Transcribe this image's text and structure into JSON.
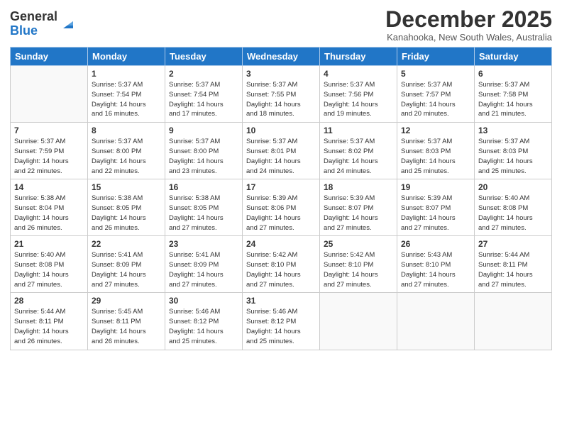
{
  "header": {
    "logo_general": "General",
    "logo_blue": "Blue",
    "month_title": "December 2025",
    "subtitle": "Kanahooka, New South Wales, Australia"
  },
  "days_of_week": [
    "Sunday",
    "Monday",
    "Tuesday",
    "Wednesday",
    "Thursday",
    "Friday",
    "Saturday"
  ],
  "weeks": [
    [
      {
        "day": "",
        "info": ""
      },
      {
        "day": "1",
        "info": "Sunrise: 5:37 AM\nSunset: 7:54 PM\nDaylight: 14 hours\nand 16 minutes."
      },
      {
        "day": "2",
        "info": "Sunrise: 5:37 AM\nSunset: 7:54 PM\nDaylight: 14 hours\nand 17 minutes."
      },
      {
        "day": "3",
        "info": "Sunrise: 5:37 AM\nSunset: 7:55 PM\nDaylight: 14 hours\nand 18 minutes."
      },
      {
        "day": "4",
        "info": "Sunrise: 5:37 AM\nSunset: 7:56 PM\nDaylight: 14 hours\nand 19 minutes."
      },
      {
        "day": "5",
        "info": "Sunrise: 5:37 AM\nSunset: 7:57 PM\nDaylight: 14 hours\nand 20 minutes."
      },
      {
        "day": "6",
        "info": "Sunrise: 5:37 AM\nSunset: 7:58 PM\nDaylight: 14 hours\nand 21 minutes."
      }
    ],
    [
      {
        "day": "7",
        "info": "Sunrise: 5:37 AM\nSunset: 7:59 PM\nDaylight: 14 hours\nand 22 minutes."
      },
      {
        "day": "8",
        "info": "Sunrise: 5:37 AM\nSunset: 8:00 PM\nDaylight: 14 hours\nand 22 minutes."
      },
      {
        "day": "9",
        "info": "Sunrise: 5:37 AM\nSunset: 8:00 PM\nDaylight: 14 hours\nand 23 minutes."
      },
      {
        "day": "10",
        "info": "Sunrise: 5:37 AM\nSunset: 8:01 PM\nDaylight: 14 hours\nand 24 minutes."
      },
      {
        "day": "11",
        "info": "Sunrise: 5:37 AM\nSunset: 8:02 PM\nDaylight: 14 hours\nand 24 minutes."
      },
      {
        "day": "12",
        "info": "Sunrise: 5:37 AM\nSunset: 8:03 PM\nDaylight: 14 hours\nand 25 minutes."
      },
      {
        "day": "13",
        "info": "Sunrise: 5:37 AM\nSunset: 8:03 PM\nDaylight: 14 hours\nand 25 minutes."
      }
    ],
    [
      {
        "day": "14",
        "info": "Sunrise: 5:38 AM\nSunset: 8:04 PM\nDaylight: 14 hours\nand 26 minutes."
      },
      {
        "day": "15",
        "info": "Sunrise: 5:38 AM\nSunset: 8:05 PM\nDaylight: 14 hours\nand 26 minutes."
      },
      {
        "day": "16",
        "info": "Sunrise: 5:38 AM\nSunset: 8:05 PM\nDaylight: 14 hours\nand 27 minutes."
      },
      {
        "day": "17",
        "info": "Sunrise: 5:39 AM\nSunset: 8:06 PM\nDaylight: 14 hours\nand 27 minutes."
      },
      {
        "day": "18",
        "info": "Sunrise: 5:39 AM\nSunset: 8:07 PM\nDaylight: 14 hours\nand 27 minutes."
      },
      {
        "day": "19",
        "info": "Sunrise: 5:39 AM\nSunset: 8:07 PM\nDaylight: 14 hours\nand 27 minutes."
      },
      {
        "day": "20",
        "info": "Sunrise: 5:40 AM\nSunset: 8:08 PM\nDaylight: 14 hours\nand 27 minutes."
      }
    ],
    [
      {
        "day": "21",
        "info": "Sunrise: 5:40 AM\nSunset: 8:08 PM\nDaylight: 14 hours\nand 27 minutes."
      },
      {
        "day": "22",
        "info": "Sunrise: 5:41 AM\nSunset: 8:09 PM\nDaylight: 14 hours\nand 27 minutes."
      },
      {
        "day": "23",
        "info": "Sunrise: 5:41 AM\nSunset: 8:09 PM\nDaylight: 14 hours\nand 27 minutes."
      },
      {
        "day": "24",
        "info": "Sunrise: 5:42 AM\nSunset: 8:10 PM\nDaylight: 14 hours\nand 27 minutes."
      },
      {
        "day": "25",
        "info": "Sunrise: 5:42 AM\nSunset: 8:10 PM\nDaylight: 14 hours\nand 27 minutes."
      },
      {
        "day": "26",
        "info": "Sunrise: 5:43 AM\nSunset: 8:10 PM\nDaylight: 14 hours\nand 27 minutes."
      },
      {
        "day": "27",
        "info": "Sunrise: 5:44 AM\nSunset: 8:11 PM\nDaylight: 14 hours\nand 27 minutes."
      }
    ],
    [
      {
        "day": "28",
        "info": "Sunrise: 5:44 AM\nSunset: 8:11 PM\nDaylight: 14 hours\nand 26 minutes."
      },
      {
        "day": "29",
        "info": "Sunrise: 5:45 AM\nSunset: 8:11 PM\nDaylight: 14 hours\nand 26 minutes."
      },
      {
        "day": "30",
        "info": "Sunrise: 5:46 AM\nSunset: 8:12 PM\nDaylight: 14 hours\nand 25 minutes."
      },
      {
        "day": "31",
        "info": "Sunrise: 5:46 AM\nSunset: 8:12 PM\nDaylight: 14 hours\nand 25 minutes."
      },
      {
        "day": "",
        "info": ""
      },
      {
        "day": "",
        "info": ""
      },
      {
        "day": "",
        "info": ""
      }
    ]
  ]
}
